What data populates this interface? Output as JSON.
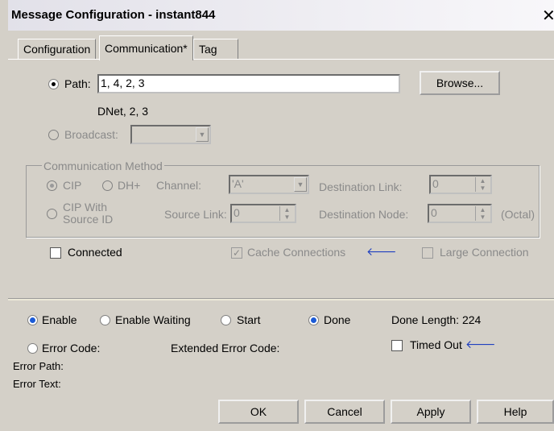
{
  "window": {
    "title": "Message Configuration - instant844",
    "close": "✕"
  },
  "tabs": [
    {
      "label": "Configuration"
    },
    {
      "label": "Communication*"
    },
    {
      "label": "Tag"
    }
  ],
  "path": {
    "label": "Path:",
    "value": "1, 4, 2, 3",
    "browse": "Browse...",
    "resolved": "DNet, 2, 3"
  },
  "broadcast": {
    "label": "Broadcast:"
  },
  "comm_method": {
    "legend": "Communication Method",
    "cip": "CIP",
    "dh": "DH+",
    "channel_label": "Channel:",
    "channel_value": "'A'",
    "dest_link_label": "Destination Link:",
    "dest_link_value": "0",
    "cip_source_id": "CIP With\nSource ID",
    "source_link_label": "Source Link:",
    "source_link_value": "0",
    "dest_node_label": "Destination Node:",
    "dest_node_value": "0",
    "octal": "(Octal)"
  },
  "options": {
    "connected": "Connected",
    "cache": "Cache Connections",
    "large": "Large Connection"
  },
  "status": {
    "enable": "Enable",
    "enable_waiting": "Enable Waiting",
    "start": "Start",
    "done": "Done",
    "done_length": "Done Length: 224",
    "error_code": "Error Code:",
    "extended_error": "Extended Error Code:",
    "timed_out": "Timed Out",
    "error_path": "Error Path:",
    "error_text": "Error Text:"
  },
  "buttons": {
    "ok": "OK",
    "cancel": "Cancel",
    "apply": "Apply",
    "help": "Help"
  },
  "colors": {
    "accent": "#1c5bd6",
    "arrow": "#2040c0"
  }
}
